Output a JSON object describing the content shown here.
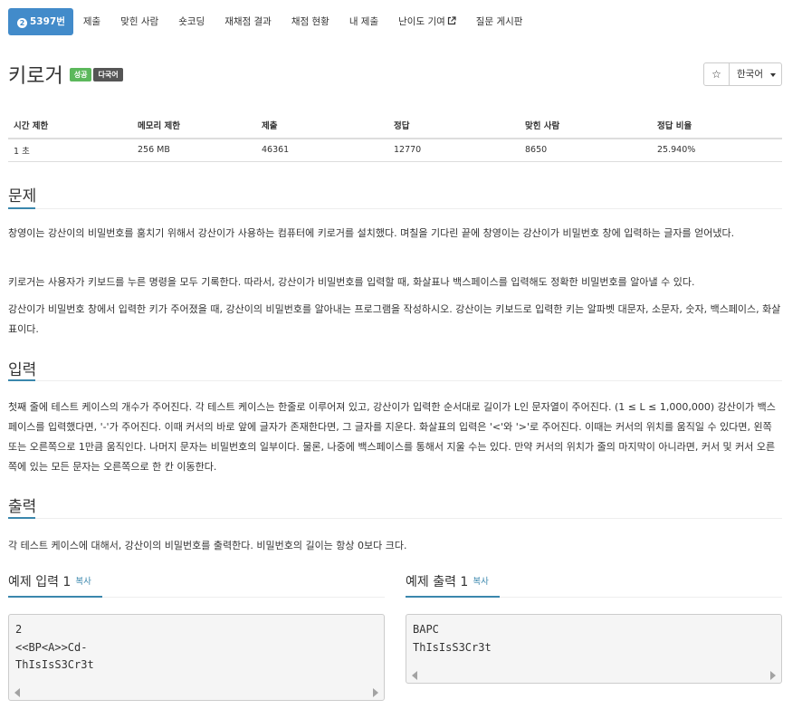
{
  "tabs": {
    "problem_number": "5397번",
    "items": [
      "제출",
      "맞힌 사람",
      "숏코딩",
      "재채점 결과",
      "채점 현황",
      "내 제출",
      "난이도 기여",
      "질문 게시판"
    ]
  },
  "problem": {
    "title": "키로거",
    "label_success": "성공",
    "label_multilang": "다국어",
    "star_icon": "☆",
    "language_select": "한국어"
  },
  "info_table": {
    "headers": [
      "시간 제한",
      "메모리 제한",
      "제출",
      "정답",
      "맞힌 사람",
      "정답 비율"
    ],
    "values": [
      "1 초",
      "256 MB",
      "46361",
      "12770",
      "8650",
      "25.940%"
    ]
  },
  "sections": {
    "description": {
      "heading": "문제",
      "paragraphs": [
        "창영이는 강산이의 비밀번호를 훔치기 위해서 강산이가 사용하는 컴퓨터에 키로거를 설치했다. 며칠을 기다린 끝에 창영이는 강산이가 비밀번호 창에 입력하는 글자를 얻어냈다.",
        "키로거는 사용자가 키보드를 누른 명령을 모두 기록한다. 따라서, 강산이가 비밀번호를 입력할 때, 화살표나 백스페이스를 입력해도 정확한 비밀번호를 알아낼 수 있다.",
        "강산이가 비밀번호 창에서 입력한 키가 주어졌을 때, 강산이의 비밀번호를 알아내는 프로그램을 작성하시오. 강산이는 키보드로 입력한 키는 알파벳 대문자, 소문자, 숫자, 백스페이스, 화살표이다."
      ]
    },
    "input": {
      "heading": "입력",
      "text": "첫째 줄에 테스트 케이스의 개수가 주어진다. 각 테스트 케이스는 한줄로 이루어져 있고, 강산이가 입력한 순서대로 길이가 L인 문자열이 주어진다. (1 ≤ L ≤ 1,000,000) 강산이가 백스페이스를 입력했다면, '-'가 주어진다. 이때 커서의 바로 앞에 글자가 존재한다면, 그 글자를 지운다. 화살표의 입력은 '<'와 '>'로 주어진다. 이때는 커서의 위치를 움직일 수 있다면, 왼쪽 또는 오른쪽으로 1만큼 움직인다. 나머지 문자는 비밀번호의 일부이다. 물론, 나중에 백스페이스를 통해서 지울 수는 있다. 만약 커서의 위치가 줄의 마지막이 아니라면, 커서 및 커서 오른쪽에 있는 모든 문자는 오른쪽으로 한 칸 이동한다."
    },
    "output": {
      "heading": "출력",
      "text": "각 테스트 케이스에 대해서, 강산이의 비밀번호를 출력한다. 비밀번호의 길이는 항상 0보다 크다."
    }
  },
  "samples": {
    "input": {
      "heading": "예제 입력 1",
      "copy_label": "복사",
      "content": "2\n<<BP<A>>Cd-\nThIsIsS3Cr3t"
    },
    "output": {
      "heading": "예제 출력 1",
      "copy_label": "복사",
      "content": "BAPC\nThIsIsS3Cr3t"
    }
  }
}
